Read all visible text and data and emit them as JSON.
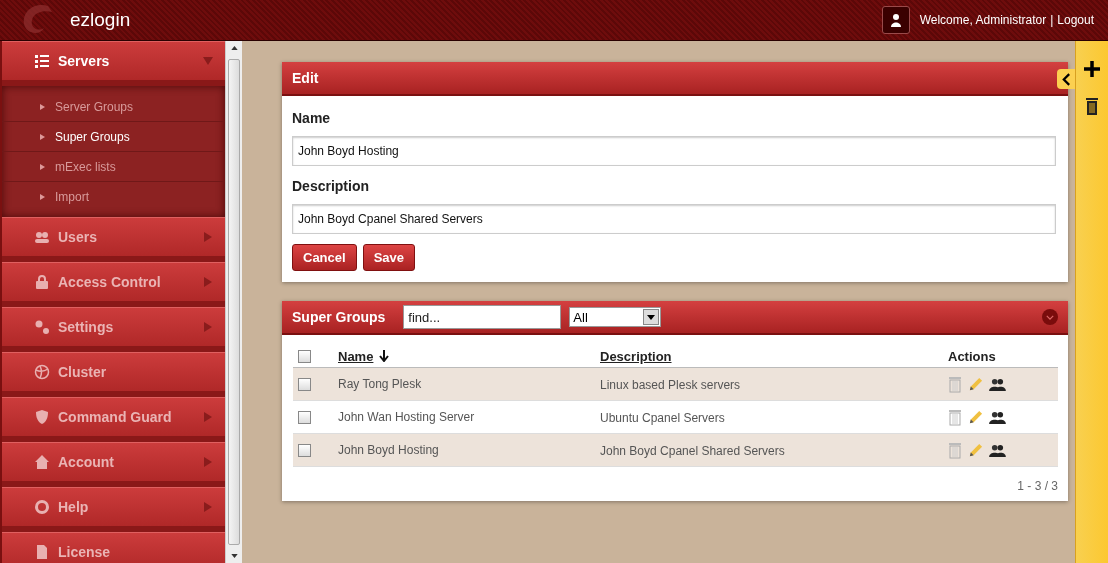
{
  "header": {
    "app_name": "ezlogin",
    "welcome": "Welcome, Administrator",
    "separator": "|",
    "logout": "Logout"
  },
  "sidebar": {
    "items": [
      {
        "label": "Servers",
        "expanded": true,
        "has_submenu": true,
        "children": [
          {
            "label": "Server Groups",
            "selected": false
          },
          {
            "label": "Super Groups",
            "selected": true
          },
          {
            "label": "mExec lists",
            "selected": false
          },
          {
            "label": "Import",
            "selected": false
          }
        ]
      },
      {
        "label": "Users",
        "expanded": false,
        "has_submenu": true
      },
      {
        "label": "Access Control",
        "expanded": false,
        "has_submenu": true
      },
      {
        "label": "Settings",
        "expanded": false,
        "has_submenu": true
      },
      {
        "label": "Cluster",
        "expanded": false,
        "has_submenu": false
      },
      {
        "label": "Command Guard",
        "expanded": false,
        "has_submenu": true
      },
      {
        "label": "Account",
        "expanded": false,
        "has_submenu": true
      },
      {
        "label": "Help",
        "expanded": false,
        "has_submenu": true
      },
      {
        "label": "License",
        "expanded": false,
        "has_submenu": false
      }
    ]
  },
  "edit_panel": {
    "title": "Edit",
    "fields": [
      {
        "label": "Name",
        "value": "John Boyd Hosting"
      },
      {
        "label": "Description",
        "value": "John Boyd Cpanel Shared Servers"
      }
    ],
    "buttons": [
      "Cancel",
      "Save"
    ]
  },
  "table_panel": {
    "title": "Super Groups",
    "search": {
      "placeholder": "find..."
    },
    "filter": {
      "value": "All"
    },
    "columns": [
      "Name",
      "Description",
      "Actions"
    ],
    "select_all": {
      "checked": false
    },
    "rows": [
      {
        "name": "Ray Tong Plesk",
        "description": "Linux based Plesk servers",
        "checked": false
      },
      {
        "name": "John Wan Hosting Server",
        "description": "Ubuntu Cpanel Servers",
        "checked": false
      },
      {
        "name": "John Boyd Hosting",
        "description": "John Boyd Cpanel Shared Servers",
        "checked": false
      }
    ],
    "pagination": "1 - 3 / 3"
  }
}
